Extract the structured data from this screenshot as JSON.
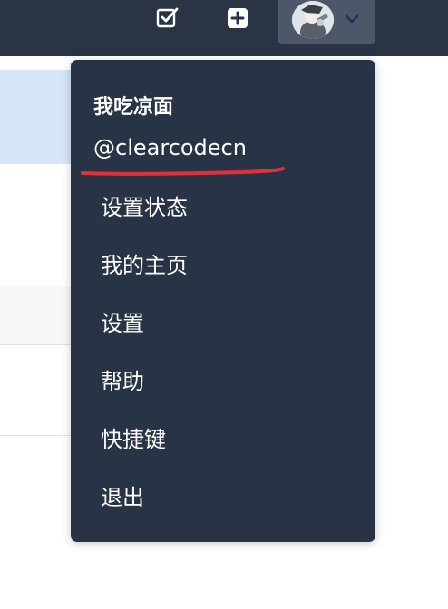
{
  "header": {
    "todo_icon": "checkbox-edit-icon",
    "create_icon": "plus-square-icon",
    "avatar_icon": "user-avatar",
    "dropdown_icon": "chevron-down-icon"
  },
  "user_menu": {
    "name": "我吃凉面",
    "handle": "@clearcodecn",
    "items": [
      {
        "label": "设置状态"
      },
      {
        "label": "我的主页"
      },
      {
        "label": "设置"
      },
      {
        "label": "帮助"
      },
      {
        "label": "快捷键"
      },
      {
        "label": "退出"
      }
    ]
  },
  "colors": {
    "topbar": "#2b3445",
    "dropdown_bg": "#283345",
    "active_trigger": "#4d5769",
    "highlight_block": "#d6e5f7",
    "annotation_red": "#e0303b"
  }
}
